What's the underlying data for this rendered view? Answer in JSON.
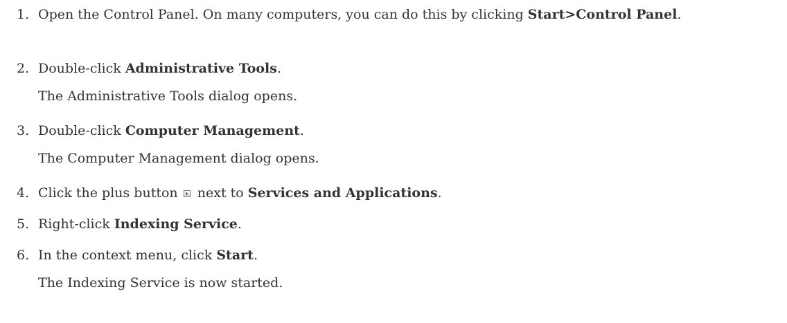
{
  "steps": [
    {
      "number": "1.",
      "pre": "Open the Control Panel. On many computers, you can do this by clicking ",
      "bold": "Start>Control Panel",
      "post": "."
    },
    {
      "number": "2.",
      "pre": "Double-click ",
      "bold": "Administrative Tools",
      "post": ".",
      "result": "The Administrative Tools dialog opens."
    },
    {
      "number": "3.",
      "pre": "Double-click ",
      "bold": "Computer Management",
      "post": ".",
      "result": "The Computer Management dialog opens."
    },
    {
      "number": "4.",
      "pre": "Click the plus button ",
      "icon": "plus-box-icon",
      "mid": " next to ",
      "bold": "Services and Applications",
      "post": "."
    },
    {
      "number": "5.",
      "pre": "Right-click ",
      "bold": "Indexing Service",
      "post": "."
    },
    {
      "number": "6.",
      "pre": "In the context menu, click ",
      "bold": "Start",
      "post": ".",
      "result": "The Indexing Service is now started."
    }
  ]
}
